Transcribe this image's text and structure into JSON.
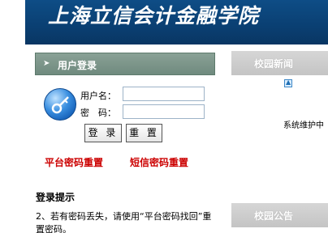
{
  "banner": {
    "title": "上海立信会计金融学院"
  },
  "login": {
    "header_title": "用户登录",
    "username_label": "用户名：",
    "password_label": "密　码：",
    "username_value": "",
    "password_value": "",
    "login_button": "登 录",
    "reset_button": "重 置",
    "platform_reset_link": "平台密码重置",
    "sms_reset_link": "短信密码重置"
  },
  "tips": {
    "title": "登录提示",
    "text": "2、若有密码丢失，请使用“平台密码找回”重置密码。"
  },
  "side": {
    "news_title": "校园新闻",
    "news_text": "系统维护中",
    "notice_title": "校园公告"
  },
  "colors": {
    "banner": "#0e4d86",
    "accent_red": "#cc0000",
    "login_header": "#7d968a"
  }
}
